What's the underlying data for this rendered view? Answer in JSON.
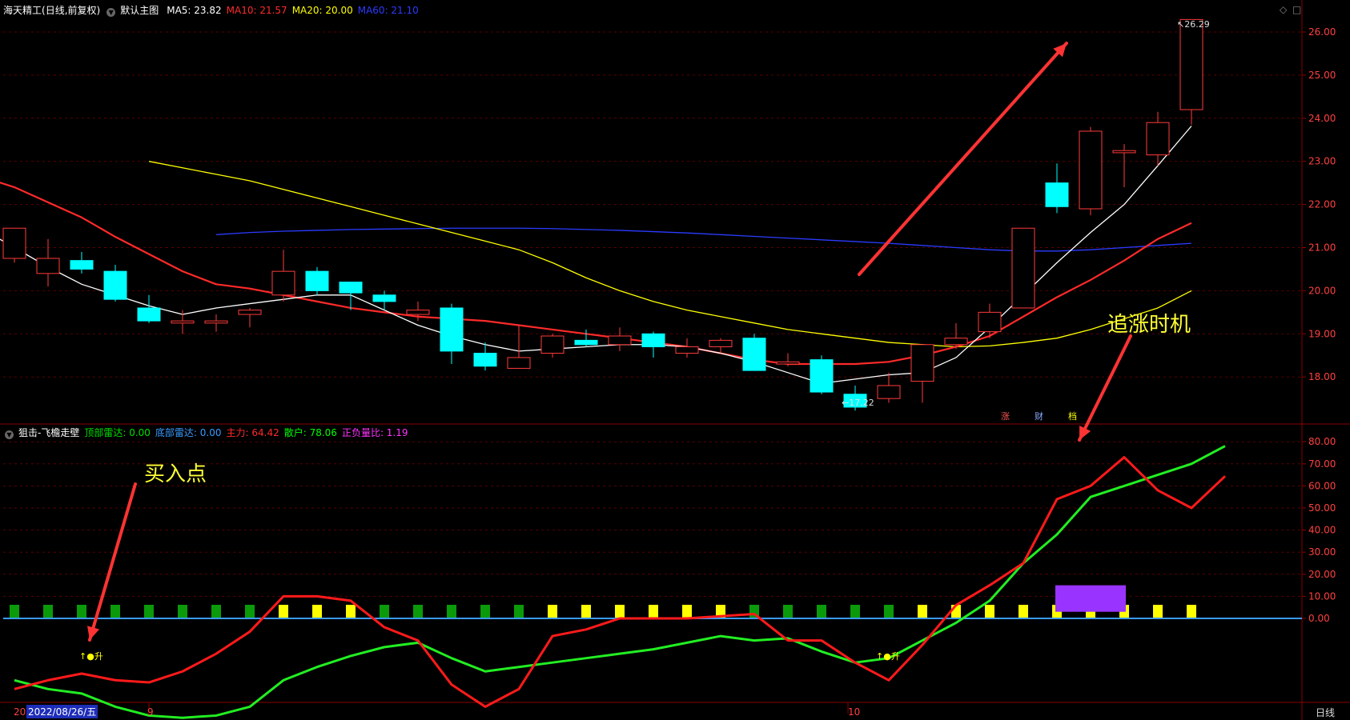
{
  "header": {
    "stock_name": "海天精工",
    "period": "(日线,前复权)",
    "main_chart_label": "默认主图",
    "ma": [
      {
        "label": "MA5: 23.82",
        "color": "#ffffff"
      },
      {
        "label": "MA10: 21.57",
        "color": "#ff2a2a"
      },
      {
        "label": "MA20: 20.00",
        "color": "#ffff00"
      },
      {
        "label": "MA60: 21.10",
        "color": "#2b3bff"
      }
    ],
    "window_controls": [
      "◇",
      "□"
    ]
  },
  "indicator_header": {
    "name": "狙击-飞檐走壁",
    "items": [
      {
        "label": "顶部雷达: 0.00",
        "color": "#00e000"
      },
      {
        "label": "底部雷达: 0.00",
        "color": "#3a9bff"
      },
      {
        "label": "主力: 64.42",
        "color": "#ff2a2a"
      },
      {
        "label": "散户: 78.06",
        "color": "#00ff00"
      },
      {
        "label": "正负量比: 1.19",
        "color": "#ff33ff"
      }
    ]
  },
  "annotations": {
    "buy_point": "买入点",
    "chase_timing": "追涨时机",
    "signal": "↑●升",
    "max_label": "26.29",
    "min_label": "17.22"
  },
  "events": [
    {
      "label": "涨",
      "color": "#ff5555"
    },
    {
      "label": "财",
      "color": "#88aaff"
    },
    {
      "label": "档",
      "color": "#ffff00"
    }
  ],
  "footer": {
    "date_cursor": "2022/08/26/五",
    "left_stub": "20",
    "month_9": "9",
    "month_10": "10",
    "period_button": "日线"
  },
  "colors": {
    "up": "#ff3b3b",
    "down": "#00ffff",
    "grid": "#5a0000",
    "axis_text": "#ff4040",
    "ma5": "#ffffff",
    "ma10": "#ff2a2a",
    "ma20": "#ffff00",
    "ma60": "#2b3bff",
    "zhuli": "#ff1a1a",
    "sanhu": "#22ee22",
    "zero_line": "#3a9bff",
    "sq_green": "#0a9a0a",
    "sq_yellow": "#ffff00",
    "volume_box": "#9933ff",
    "arrow": "#ff3333"
  },
  "chart_data": [
    {
      "type": "candlestick",
      "title": "海天精工 (日线,前复权)",
      "ylim": [
        17.0,
        26.5
      ],
      "yticks": [
        18.0,
        19.0,
        20.0,
        21.0,
        22.0,
        23.0,
        24.0,
        25.0,
        26.0
      ],
      "grid": true,
      "candles": [
        {
          "o": 20.75,
          "h": 21.45,
          "l": 20.65,
          "c": 21.45
        },
        {
          "o": 20.4,
          "h": 21.2,
          "l": 20.1,
          "c": 20.75
        },
        {
          "o": 20.7,
          "h": 20.9,
          "l": 20.4,
          "c": 20.5
        },
        {
          "o": 20.45,
          "h": 20.6,
          "l": 19.75,
          "c": 19.8
        },
        {
          "o": 19.6,
          "h": 19.9,
          "l": 19.25,
          "c": 19.3
        },
        {
          "o": 19.25,
          "h": 19.55,
          "l": 19.0,
          "c": 19.3
        },
        {
          "o": 19.25,
          "h": 19.45,
          "l": 19.05,
          "c": 19.3
        },
        {
          "o": 19.45,
          "h": 19.6,
          "l": 19.15,
          "c": 19.55
        },
        {
          "o": 19.9,
          "h": 20.95,
          "l": 19.75,
          "c": 20.45
        },
        {
          "o": 20.45,
          "h": 20.55,
          "l": 19.9,
          "c": 20.0
        },
        {
          "o": 20.2,
          "h": 20.2,
          "l": 19.55,
          "c": 19.95
        },
        {
          "o": 19.9,
          "h": 20.0,
          "l": 19.55,
          "c": 19.75
        },
        {
          "o": 19.45,
          "h": 19.75,
          "l": 19.3,
          "c": 19.55
        },
        {
          "o": 19.6,
          "h": 19.7,
          "l": 18.3,
          "c": 18.6
        },
        {
          "o": 18.55,
          "h": 18.8,
          "l": 18.15,
          "c": 18.25
        },
        {
          "o": 18.2,
          "h": 19.2,
          "l": 18.2,
          "c": 18.45
        },
        {
          "o": 18.55,
          "h": 19.0,
          "l": 18.45,
          "c": 18.95
        },
        {
          "o": 18.85,
          "h": 19.1,
          "l": 18.7,
          "c": 18.75
        },
        {
          "o": 18.75,
          "h": 19.15,
          "l": 18.6,
          "c": 18.95
        },
        {
          "o": 19.0,
          "h": 19.05,
          "l": 18.45,
          "c": 18.7
        },
        {
          "o": 18.55,
          "h": 18.9,
          "l": 18.45,
          "c": 18.7
        },
        {
          "o": 18.7,
          "h": 18.9,
          "l": 18.55,
          "c": 18.85
        },
        {
          "o": 18.9,
          "h": 19.0,
          "l": 18.15,
          "c": 18.15
        },
        {
          "o": 18.3,
          "h": 18.55,
          "l": 18.25,
          "c": 18.35
        },
        {
          "o": 18.4,
          "h": 18.5,
          "l": 17.6,
          "c": 17.65
        },
        {
          "o": 17.6,
          "h": 17.8,
          "l": 17.22,
          "c": 17.3
        },
        {
          "o": 17.5,
          "h": 18.1,
          "l": 17.4,
          "c": 17.8
        },
        {
          "o": 17.9,
          "h": 18.7,
          "l": 17.4,
          "c": 18.75
        },
        {
          "o": 18.75,
          "h": 19.25,
          "l": 18.65,
          "c": 18.9
        },
        {
          "o": 19.05,
          "h": 19.7,
          "l": 18.9,
          "c": 19.5
        },
        {
          "o": 19.6,
          "h": 21.45,
          "l": 19.6,
          "c": 21.45
        },
        {
          "o": 22.5,
          "h": 22.95,
          "l": 21.8,
          "c": 21.95
        },
        {
          "o": 21.9,
          "h": 23.8,
          "l": 21.75,
          "c": 23.7
        },
        {
          "o": 23.2,
          "h": 23.4,
          "l": 22.4,
          "c": 23.25
        },
        {
          "o": 23.15,
          "h": 24.15,
          "l": 22.9,
          "c": 23.9
        },
        {
          "o": 24.2,
          "h": 26.29,
          "l": 23.85,
          "c": 26.29
        }
      ],
      "ma5": [
        21.9,
        21.45,
        21.0,
        20.55,
        20.15,
        19.9,
        19.65,
        19.45,
        19.6,
        19.7,
        19.8,
        19.9,
        19.9,
        19.55,
        19.2,
        18.95,
        18.75,
        18.6,
        18.65,
        18.7,
        18.75,
        18.75,
        18.7,
        18.55,
        18.35,
        18.1,
        17.85,
        17.95,
        18.05,
        18.1,
        18.45,
        19.15,
        19.9,
        20.65,
        21.35,
        22.0,
        22.9,
        23.82
      ],
      "ma10": [
        22.65,
        22.4,
        22.05,
        21.7,
        21.25,
        20.85,
        20.45,
        20.15,
        20.05,
        19.9,
        19.75,
        19.6,
        19.5,
        19.4,
        19.35,
        19.3,
        19.2,
        19.1,
        19.0,
        18.9,
        18.8,
        18.7,
        18.55,
        18.4,
        18.3,
        18.3,
        18.3,
        18.35,
        18.5,
        18.7,
        18.95,
        19.4,
        19.85,
        20.25,
        20.7,
        21.2,
        21.57
      ],
      "ma20": [
        23.0,
        22.85,
        22.7,
        22.55,
        22.35,
        22.15,
        21.95,
        21.75,
        21.55,
        21.35,
        21.15,
        20.95,
        20.65,
        20.3,
        20.0,
        19.75,
        19.55,
        19.4,
        19.25,
        19.1,
        19.0,
        18.9,
        18.8,
        18.75,
        18.7,
        18.72,
        18.8,
        18.9,
        19.1,
        19.35,
        19.6,
        20.0
      ],
      "ma60": [
        21.3,
        21.35,
        21.38,
        21.4,
        21.42,
        21.43,
        21.44,
        21.45,
        21.45,
        21.45,
        21.44,
        21.42,
        21.4,
        21.37,
        21.34,
        21.3,
        21.26,
        21.22,
        21.18,
        21.14,
        21.1,
        21.05,
        21.0,
        20.95,
        20.92,
        20.92,
        20.95,
        21.0,
        21.05,
        21.1
      ],
      "max_index": 35,
      "min_index": 25
    },
    {
      "type": "line",
      "title": "狙击-飞檐走壁",
      "ylim": [
        -45,
        85
      ],
      "yticks": [
        0,
        10,
        20,
        30,
        40,
        50,
        60,
        70,
        80
      ],
      "grid": true,
      "series": [
        {
          "name": "主力",
          "values": [
            -32,
            -28,
            -25,
            -28,
            -29,
            -24,
            -16,
            -6,
            10,
            10,
            8,
            -4,
            -10,
            -30,
            -40,
            -32,
            -8,
            -5,
            0,
            0,
            0,
            1,
            2,
            -10,
            -10,
            -20,
            -28,
            -12,
            6,
            15,
            25,
            54,
            60,
            73,
            58,
            50,
            64.42
          ]
        },
        {
          "name": "散户",
          "values": [
            -28,
            -32,
            -34,
            -40,
            -44,
            -45,
            -44,
            -40,
            -28,
            -22,
            -17,
            -13,
            -11,
            -18,
            -24,
            -22,
            -20,
            -18,
            -16,
            -14,
            -11,
            -8,
            -10,
            -9,
            -15,
            -20,
            -18,
            -10,
            -2,
            8,
            25,
            38,
            55,
            60,
            65,
            70,
            78.06
          ]
        }
      ],
      "squares": [
        "g",
        "g",
        "g",
        "g",
        "g",
        "g",
        "g",
        "g",
        "y",
        "y",
        "y",
        "g",
        "g",
        "g",
        "g",
        "g",
        "y",
        "y",
        "y",
        "y",
        "y",
        "y",
        "g",
        "g",
        "g",
        "g",
        "g",
        "y",
        "y",
        "y",
        "y",
        "y",
        "y",
        "y",
        "y",
        "y"
      ],
      "volume_box": {
        "from_index": 31,
        "to_index": 33,
        "top": 15,
        "bottom": 3
      }
    }
  ]
}
